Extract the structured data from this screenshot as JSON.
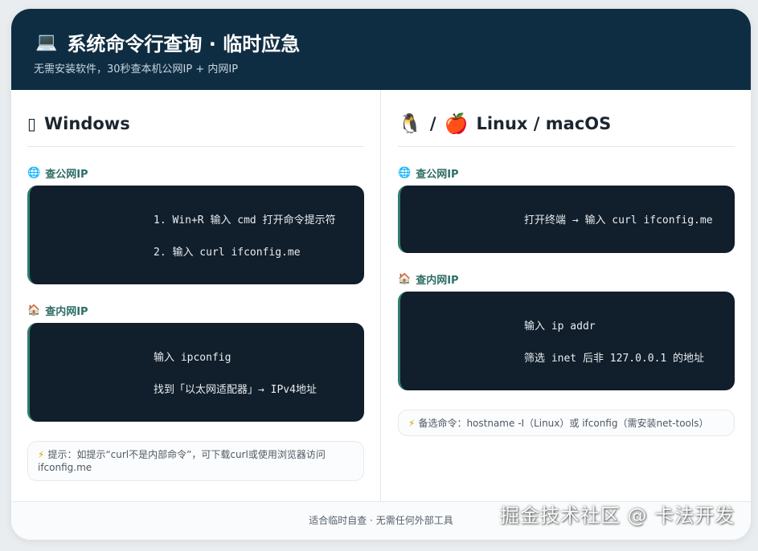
{
  "header": {
    "icon": "💻",
    "title": "系统命令行查询 · 临时应急",
    "subtitle": "无需安装软件，30秒查本机公网IP + 内网IP"
  },
  "windows": {
    "icon": "▯",
    "heading": "Windows",
    "public_ip": {
      "icon": "🌐",
      "label": "查公网IP",
      "lines": [
        "1. Win+R 输入 cmd 打开命令提示符",
        "2. 输入 curl ifconfig.me"
      ]
    },
    "private_ip": {
      "icon": "🏠",
      "label": "查内网IP",
      "lines": [
        "输入 ipconfig",
        "找到「以太网适配器」→ IPv4地址"
      ]
    },
    "tip": {
      "icon": "⚡",
      "text": "提示：如提示“curl不是内部命令”，可下载curl或使用浏览器访问ifconfig.me"
    }
  },
  "linux": {
    "icon1": "🐧",
    "separator": "/",
    "icon2": "🍎",
    "heading": "Linux / macOS",
    "public_ip": {
      "icon": "🌐",
      "label": "查公网IP",
      "lines": [
        "打开终端 → 输入 curl ifconfig.me"
      ]
    },
    "private_ip": {
      "icon": "🏠",
      "label": "查内网IP",
      "lines": [
        "输入 ip addr",
        "筛选 inet 后非 127.0.0.1 的地址"
      ]
    },
    "tip": {
      "icon": "⚡",
      "text": "备选命令：hostname -I（Linux）或 ifconfig（需安装net-tools）"
    }
  },
  "footer": {
    "text": "适合临时自查 · 无需任何外部工具"
  },
  "watermark": "掘金技术社区 @ 卡法开发",
  "colors": {
    "header_bg": "#0f2d42",
    "code_bg": "#111e2b",
    "accent": "#2f7d6e"
  }
}
